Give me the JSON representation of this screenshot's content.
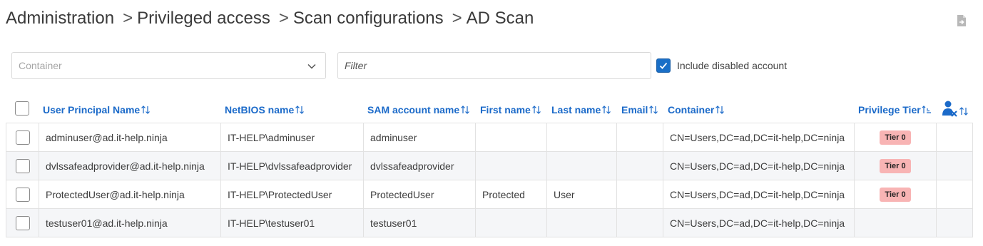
{
  "breadcrumb": [
    "Administration",
    "Privileged access",
    "Scan configurations",
    "AD Scan"
  ],
  "breadcrumb_separator": ">",
  "container_select": {
    "placeholder": "Container"
  },
  "filter": {
    "placeholder": "Filter",
    "value": ""
  },
  "include_disabled": {
    "label": "Include disabled account",
    "checked": true
  },
  "columns": {
    "upn": "User Principal Name",
    "netbios": "NetBIOS name",
    "sam": "SAM account name",
    "first_name": "First name",
    "last_name": "Last name",
    "email": "Email",
    "container": "Container",
    "privilege_tier": "Privilege Tier"
  },
  "rows": [
    {
      "upn": "adminuser@ad.it-help.ninja",
      "netbios": "IT-HELP\\adminuser",
      "sam": "adminuser",
      "first_name": "",
      "last_name": "",
      "email": "",
      "container": "CN=Users,DC=ad,DC=it-help,DC=ninja",
      "tier": "Tier 0"
    },
    {
      "upn": "dvlssafeadprovider@ad.it-help.ninja",
      "netbios": "IT-HELP\\dvlssafeadprovider",
      "sam": "dvlssafeadprovider",
      "first_name": "",
      "last_name": "",
      "email": "",
      "container": "CN=Users,DC=ad,DC=it-help,DC=ninja",
      "tier": "Tier 0"
    },
    {
      "upn": "ProtectedUser@ad.it-help.ninja",
      "netbios": "IT-HELP\\ProtectedUser",
      "sam": "ProtectedUser",
      "first_name": "Protected",
      "last_name": "User",
      "email": "",
      "container": "CN=Users,DC=ad,DC=it-help,DC=ninja",
      "tier": "Tier 0"
    },
    {
      "upn": "testuser01@ad.it-help.ninja",
      "netbios": "IT-HELP\\testuser01",
      "sam": "testuser01",
      "first_name": "",
      "last_name": "",
      "email": "",
      "container": "CN=Users,DC=ad,DC=it-help,DC=ninja",
      "tier": ""
    }
  ],
  "colors": {
    "accent": "#1b6ac9",
    "tier_badge": "#f8b4b4",
    "row_alt": "#f5f6f8"
  },
  "icons": {
    "export": "export-icon",
    "dropdown": "chevron-down-icon",
    "sort": "sort-arrows-icon",
    "tier_sort": "sort-ascending-icon",
    "disabled_user": "user-disabled-icon",
    "check": "checkmark-icon"
  }
}
